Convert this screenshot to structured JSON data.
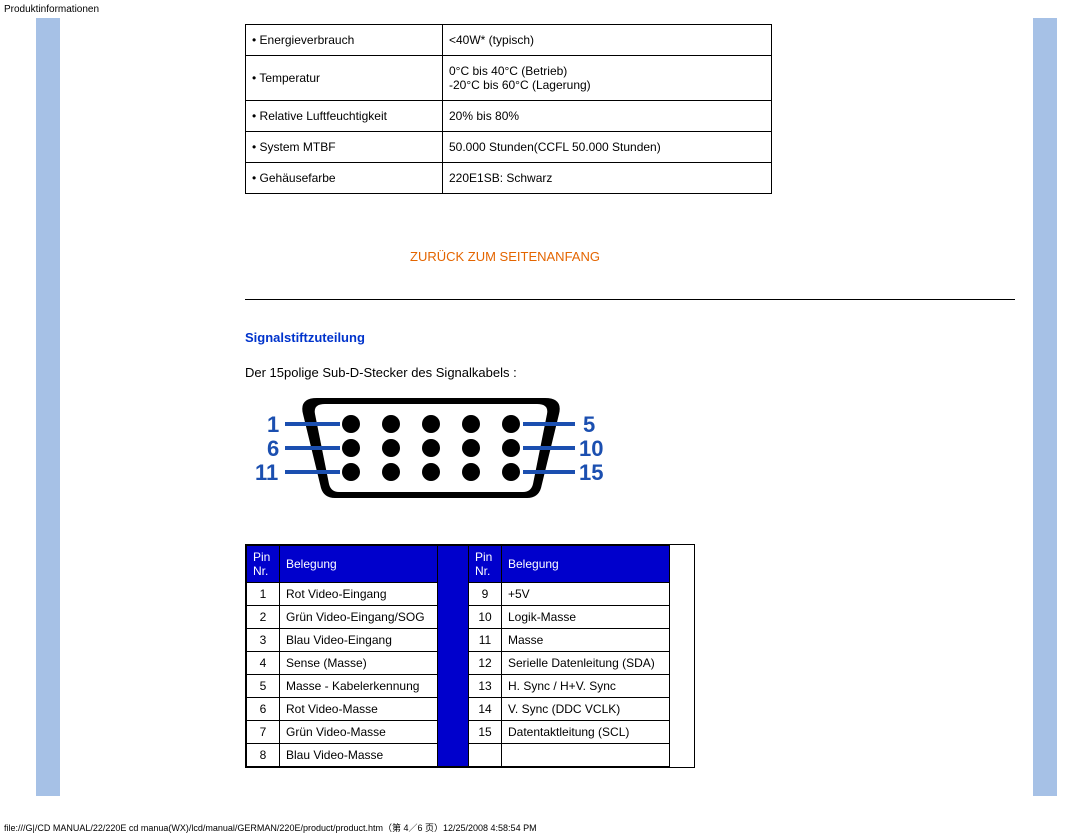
{
  "header": "Produktinformationen",
  "specs": [
    {
      "label": "• Energieverbrauch",
      "value": "<40W* (typisch)"
    },
    {
      "label": "• Temperatur",
      "value": "0°C bis 40°C (Betrieb)\n-20°C bis 60°C (Lagerung)"
    },
    {
      "label": "• Relative Luftfeuchtigkeit",
      "value": "20% bis 80%"
    },
    {
      "label": "• System MTBF",
      "value": "50.000 Stunden(CCFL 50.000 Stunden)"
    },
    {
      "label": "• Gehäusefarbe",
      "value": "220E1SB: Schwarz"
    }
  ],
  "back_to_top": "ZURÜCK ZUM SEITENANFANG",
  "section_title": "Signalstiftzuteilung",
  "body_text": "Der 15polige Sub-D-Stecker des Signalkabels :",
  "diagram_labels": {
    "tl": "1",
    "tr": "5",
    "ml": "6",
    "mr": "10",
    "bl": "11",
    "br": "15"
  },
  "pin_header": {
    "num": "Pin\nNr.",
    "assign": "Belegung"
  },
  "pins_left": [
    {
      "n": "1",
      "a": "Rot Video-Eingang"
    },
    {
      "n": "2",
      "a": "Grün Video-Eingang/SOG"
    },
    {
      "n": "3",
      "a": "Blau Video-Eingang"
    },
    {
      "n": "4",
      "a": "Sense (Masse)"
    },
    {
      "n": "5",
      "a": "Masse - Kabelerkennung"
    },
    {
      "n": "6",
      "a": "Rot Video-Masse"
    },
    {
      "n": "7",
      "a": "Grün Video-Masse"
    },
    {
      "n": "8",
      "a": "Blau Video-Masse"
    }
  ],
  "pins_right": [
    {
      "n": "9",
      "a": "+5V"
    },
    {
      "n": "10",
      "a": "Logik-Masse"
    },
    {
      "n": "11",
      "a": "Masse"
    },
    {
      "n": "12",
      "a": "Serielle Datenleitung (SDA)"
    },
    {
      "n": "13",
      "a": "H. Sync / H+V. Sync"
    },
    {
      "n": "14",
      "a": "V. Sync (DDC VCLK)"
    },
    {
      "n": "15",
      "a": "Datentaktleitung (SCL)"
    }
  ],
  "footer": "file:///G|/CD MANUAL/22/220E cd manua(WX)/lcd/manual/GERMAN/220E/product/product.htm（第 4／6 页）12/25/2008 4:58:54 PM"
}
